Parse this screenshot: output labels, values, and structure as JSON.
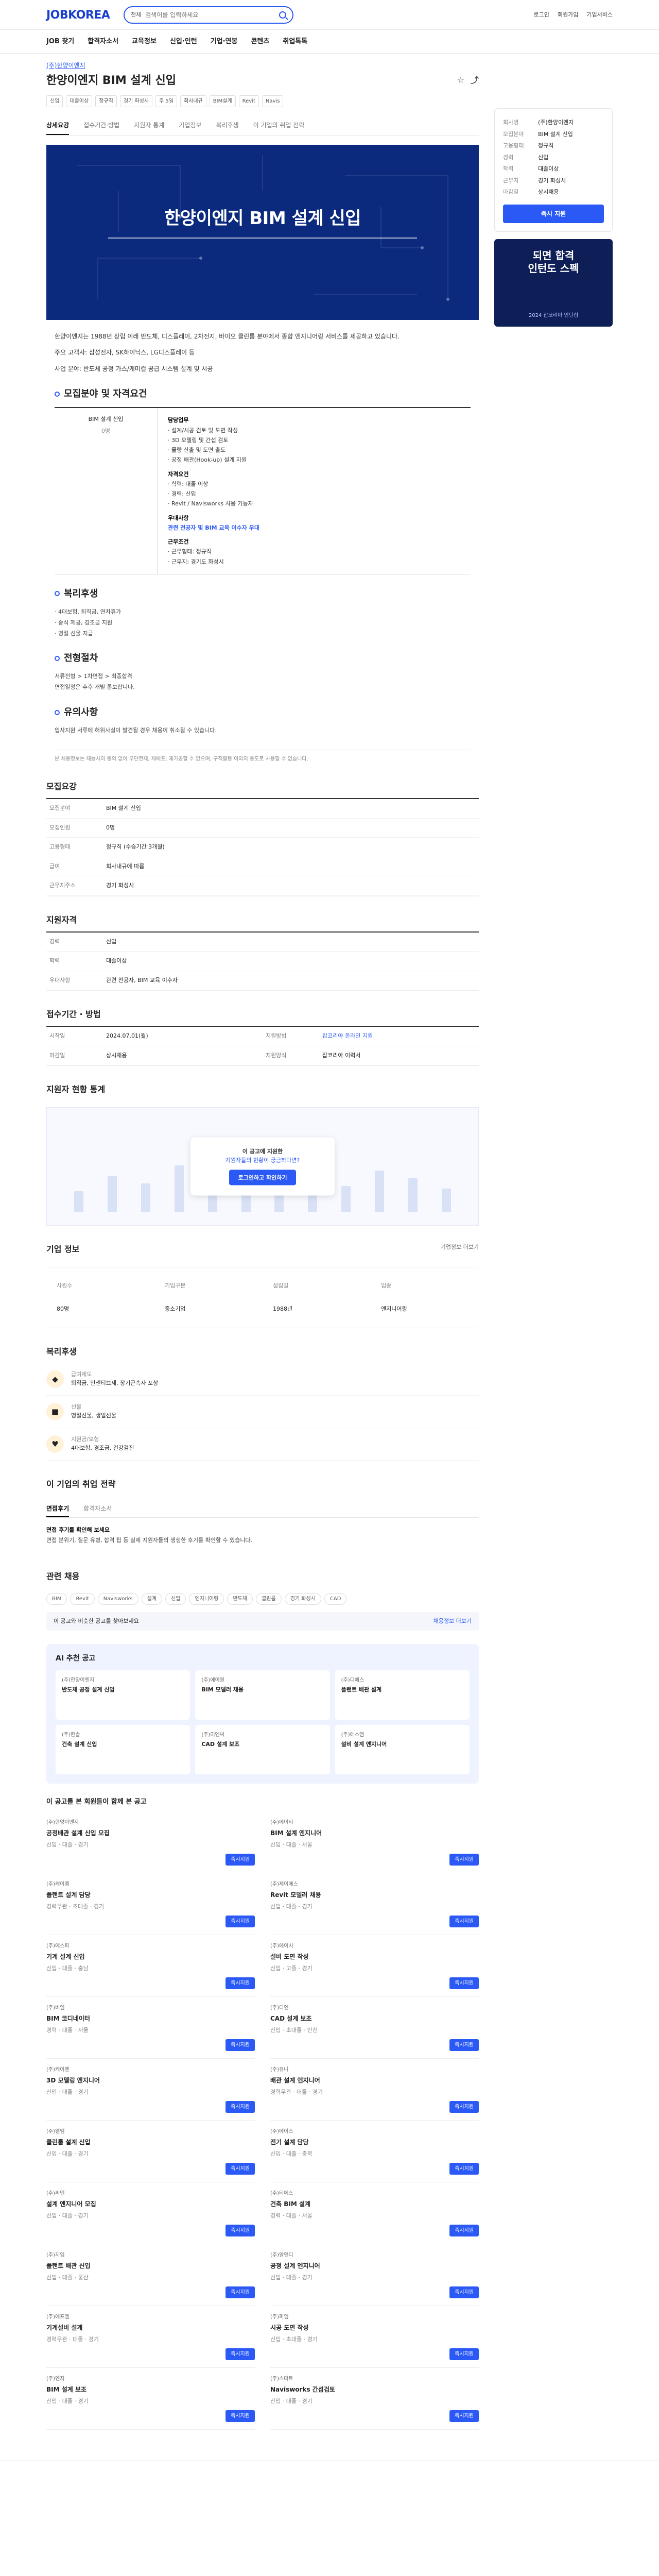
{
  "header": {
    "logo": "JOBKOREA",
    "search_scope": "전체",
    "search_placeholder": "검색어를 입력하세요",
    "right_links": [
      "로그인",
      "회원가입",
      "기업서비스"
    ]
  },
  "gnb": [
    "JOB 찾기",
    "합격자소서",
    "교육정보",
    "신입·인턴",
    "기업·연봉",
    "콘텐츠",
    "취업톡톡"
  ],
  "job": {
    "company": "(주)한양이엔지",
    "title": "한양이엔지 BIM 설계 신입",
    "tags": [
      "신입",
      "대졸이상",
      "정규직",
      "경기 화성시",
      "주 5일",
      "회사내규",
      "BIM설계",
      "Revit",
      "Navis"
    ],
    "tabs": [
      "상세요강",
      "접수기간·방법",
      "지원자 통계",
      "기업정보",
      "복리후생",
      "이 기업의 취업 전략"
    ],
    "hero_title": "한양이엔지 BIM 설계 신입"
  },
  "intro": [
    "한양이엔지는 1988년 창립 이래 반도체, 디스플레이, 2차전지, 바이오 클린룸 분야에서 종합 엔지니어링 서비스를 제공하고 있습니다.",
    "주요 고객사: 삼성전자, SK하이닉스, LG디스플레이 등",
    "사업 분야: 반도체 공정 가스/케미컬 공급 시스템 설계 및 시공"
  ],
  "sections": {
    "requirements": "모집분야 및 자격요건",
    "welfare": "복리후생",
    "process": "전형절차",
    "caution": "유의사항"
  },
  "requirements": {
    "field": "BIM 설계 신입",
    "count": "0명",
    "duties_h": "담당업무",
    "duties": [
      "· 설계/시공 검토 및 도면 작성",
      "· 3D 모델링 및 간섭 검토",
      "· 물량 산출 및 도면 출도",
      "· 공정 배관(Hook-up) 설계 지원"
    ],
    "qual_h": "자격요건",
    "qual": [
      "· 학력: 대졸 이상",
      "· 경력: 신입",
      "· Revit / Navisworks 사용 가능자"
    ],
    "pref_h": "우대사항",
    "pref": "관련 전공자 및 BIM 교육 이수자 우대",
    "work_h": "근무조건",
    "work": [
      "· 근무형태: 정규직",
      "· 근무지: 경기도 화성시"
    ]
  },
  "welfare_list": [
    "· 4대보험, 퇴직금, 연차휴가",
    "· 중식 제공, 경조금 지원",
    "· 명절 선물 지급"
  ],
  "process_list": [
    "서류전형 > 1차면접 > 최종합격",
    "면접일정은 추후 개별 통보합니다."
  ],
  "caution_list": [
    "입사지원 서류에 허위사실이 발견될 경우 채용이 취소될 수 있습니다."
  ],
  "notice": "본 채용정보는 재능사의 동의 없이 무단전재, 재배포, 재가공할 수 없으며, 구직활동 이외의 용도로 사용할 수 없습니다.",
  "recruit_summary": {
    "title": "모집요강",
    "rows": [
      {
        "k": "모집분야",
        "v": "BIM 설계 신입"
      },
      {
        "k": "모집인원",
        "v": "0명"
      },
      {
        "k": "고용형태",
        "v": "정규직 (수습기간 3개월)"
      },
      {
        "k": "급여",
        "v": "회사내규에 따름"
      },
      {
        "k": "근무지주소",
        "v": "경기 화성시"
      }
    ]
  },
  "qualification": {
    "title": "지원자격",
    "rows": [
      {
        "k": "경력",
        "v": "신입"
      },
      {
        "k": "학력",
        "v": "대졸이상"
      },
      {
        "k": "우대사항",
        "v": "관련 전공자, BIM 교육 이수자"
      }
    ]
  },
  "apply": {
    "title": "접수기간 · 방법",
    "rows_left": [
      {
        "k": "시작일",
        "v": "2024.07.01(월)"
      },
      {
        "k": "마감일",
        "v": "상시채용"
      }
    ],
    "rows_right": [
      {
        "k": "지원방법",
        "v": "잡코리아 온라인 지원"
      },
      {
        "k": "지원양식",
        "v": "잡코리아 이력서"
      }
    ]
  },
  "stats": {
    "title": "지원자 현황 통계",
    "q": "이 공고에 지원한",
    "b": "지원자들의 현황이 궁금하다면?",
    "btn": "로그인하고 확인하기",
    "bars": [
      40,
      70,
      55,
      90,
      110,
      75,
      60,
      95,
      50,
      80,
      65,
      45
    ]
  },
  "company": {
    "title": "기업 정보",
    "more": "기업정보 더보기",
    "items": [
      {
        "k": "사원수",
        "v": "80명"
      },
      {
        "k": "기업구분",
        "v": "중소기업"
      },
      {
        "k": "설립일",
        "v": "1988년"
      },
      {
        "k": "업종",
        "v": "엔지니어링"
      }
    ]
  },
  "welfare_block": {
    "title": "복리후생",
    "items": [
      {
        "icon": "bag-icon",
        "t": "급여제도",
        "v": "퇴직금, 인센티브제, 장기근속자 포상"
      },
      {
        "icon": "gift-icon",
        "t": "선물",
        "v": "명절선물, 생일선물"
      },
      {
        "icon": "heart-icon",
        "t": "지원금/보험",
        "v": "4대보험, 경조금, 건강검진"
      }
    ]
  },
  "strategy": {
    "title": "이 기업의 취업 전략",
    "tabs": [
      "면접후기",
      "합격자소서"
    ],
    "body_title": "면접 후기를 확인해 보세요",
    "body": "면접 분위기, 질문 유형, 합격 팁 등 실제 지원자들의 생생한 후기를 확인할 수 있습니다."
  },
  "keywords": {
    "title": "관련 채용",
    "items": [
      "BIM",
      "Revit",
      "Navisworks",
      "설계",
      "신입",
      "엔지니어링",
      "반도체",
      "클린룸",
      "경기 화성시",
      "CAD"
    ]
  },
  "banner": {
    "left": "이 공고와 비슷한 공고를 찾아보세요",
    "right": "채용정보 더보기"
  },
  "recommend": {
    "title": "AI 추천 공고",
    "cards": [
      {
        "c": "(주)한양이엔지",
        "t": "반도체 공정 설계 신입"
      },
      {
        "c": "(주)에이원",
        "t": "BIM 모델러 채용"
      },
      {
        "c": "(주)디에스",
        "t": "플랜트 배관 설계"
      },
      {
        "c": "(주)한솔",
        "t": "건축 설계 신입"
      },
      {
        "c": "(주)이엔씨",
        "t": "CAD 설계 보조"
      },
      {
        "c": "(주)에스엠",
        "t": "설비 설계 엔지니어"
      }
    ]
  },
  "joblist": {
    "title": "이 공고를 본 회원들이 함께 본 공고",
    "apply": "즉시지원",
    "cards": [
      {
        "c": "(주)한양이엔지",
        "t": "공정배관 설계 신입 모집",
        "m": "신입 · 대졸 · 경기"
      },
      {
        "c": "(주)에이티",
        "t": "BIM 설계 엔지니어",
        "m": "신입 · 대졸 · 서울"
      },
      {
        "c": "(주)케이엠",
        "t": "플랜트 설계 담당",
        "m": "경력무관 · 초대졸 · 경기"
      },
      {
        "c": "(주)제이에스",
        "t": "Revit 모델러 채용",
        "m": "신입 · 대졸 · 경기"
      },
      {
        "c": "(주)에스피",
        "t": "기계 설계 신입",
        "m": "신입 · 대졸 · 충남"
      },
      {
        "c": "(주)에이치",
        "t": "설비 도면 작성",
        "m": "신입 · 고졸 · 경기"
      },
      {
        "c": "(주)비엠",
        "t": "BIM 코디네이터",
        "m": "경력 · 대졸 · 서울"
      },
      {
        "c": "(주)디엔",
        "t": "CAD 설계 보조",
        "m": "신입 · 초대졸 · 인천"
      },
      {
        "c": "(주)케이엔",
        "t": "3D 모델링 엔지니어",
        "m": "신입 · 대졸 · 경기"
      },
      {
        "c": "(주)유니",
        "t": "배관 설계 엔지니어",
        "m": "경력무관 · 대졸 · 경기"
      },
      {
        "c": "(주)엘엠",
        "t": "클린룸 설계 신입",
        "m": "신입 · 대졸 · 경기"
      },
      {
        "c": "(주)에이스",
        "t": "전기 설계 담당",
        "m": "신입 · 대졸 · 충북"
      },
      {
        "c": "(주)씨엔",
        "t": "설계 엔지니어 모집",
        "m": "신입 · 대졸 · 경기"
      },
      {
        "c": "(주)티에스",
        "t": "건축 BIM 설계",
        "m": "경력 · 대졸 · 서울"
      },
      {
        "c": "(주)지엠",
        "t": "플랜트 배관 신입",
        "m": "신입 · 대졸 · 울산"
      },
      {
        "c": "(주)알앤디",
        "t": "공정 설계 엔지니어",
        "m": "신입 · 대졸 · 경기"
      },
      {
        "c": "(주)에프엠",
        "t": "기계설비 설계",
        "m": "경력무관 · 대졸 · 경기"
      },
      {
        "c": "(주)피엠",
        "t": "시공 도면 작성",
        "m": "신입 · 초대졸 · 경기"
      },
      {
        "c": "(주)엔지",
        "t": "BIM 설계 보조",
        "m": "신입 · 대졸 · 경기"
      },
      {
        "c": "(주)스마트",
        "t": "Navisworks 간섭검토",
        "m": "신입 · 대졸 · 경기"
      }
    ]
  },
  "aside": {
    "rows": [
      {
        "k": "회사명",
        "v": "(주)한양이엔지"
      },
      {
        "k": "모집분야",
        "v": "BIM 설계 신입"
      },
      {
        "k": "고용형태",
        "v": "정규직"
      },
      {
        "k": "경력",
        "v": "신입"
      },
      {
        "k": "학력",
        "v": "대졸이상"
      },
      {
        "k": "근무지",
        "v": "경기 화성시"
      },
      {
        "k": "마감일",
        "v": "상시채용"
      }
    ],
    "btn": "즉시 지원",
    "ad_title": "되면 합격\n인턴도 스펙",
    "ad_sub": "2024 잡코리아 인턴십"
  }
}
